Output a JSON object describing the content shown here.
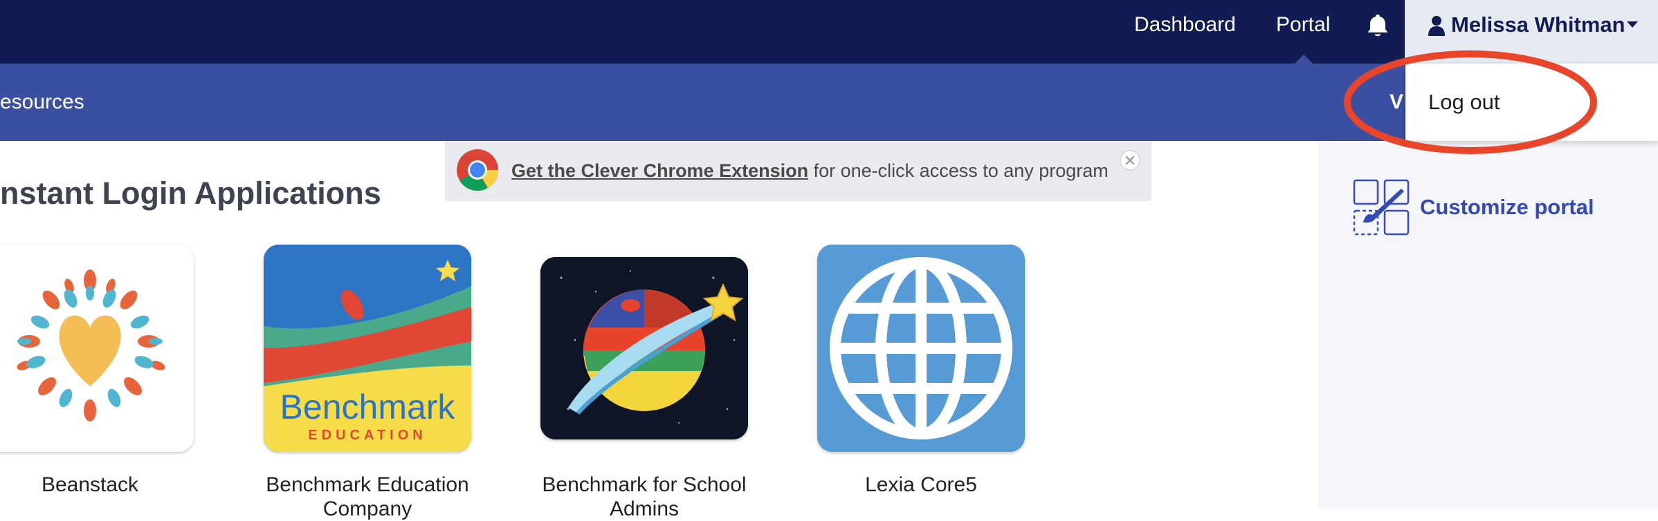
{
  "topnav": {
    "dashboard": "Dashboard",
    "portal": "Portal",
    "user_name": "Melissa Whitman"
  },
  "subnav": {
    "resources": "esources",
    "partial_tab": "V"
  },
  "user_dropdown": {
    "logout": "Log out"
  },
  "banner": {
    "link_text": "Get the Clever Chrome Extension",
    "rest_text": " for one-click access to any program"
  },
  "section_title": "nstant Login Applications",
  "apps": [
    {
      "name": "Beanstack"
    },
    {
      "name": "Benchmark Education Company"
    },
    {
      "name": "Benchmark for School Admins"
    },
    {
      "name": "Lexia Core5"
    }
  ],
  "benchmark_logo": {
    "line1": "Benchmark",
    "line2": "EDUCATION"
  },
  "sidebar": {
    "customize": "Customize portal"
  },
  "colors": {
    "topbar": "#111c54",
    "subbar": "#3b4fa0",
    "accent": "#3349b5",
    "highlight_ring": "#e8452b"
  }
}
